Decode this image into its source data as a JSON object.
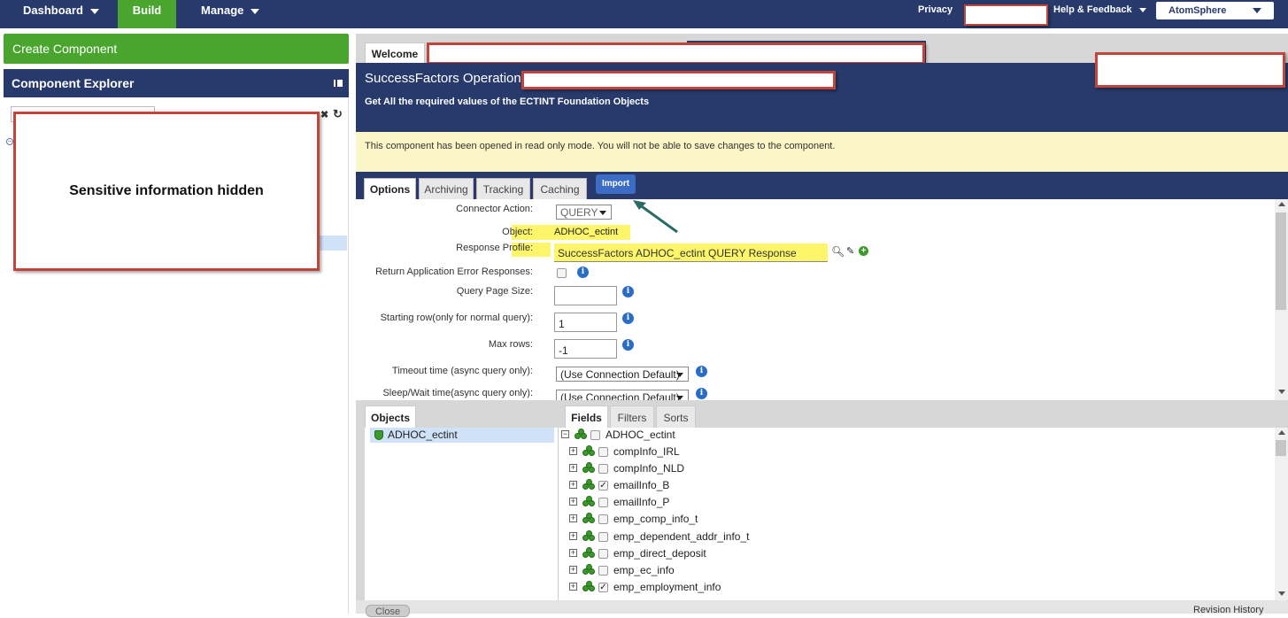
{
  "topnav": {
    "dashboard": "Dashboard",
    "build": "Build",
    "manage": "Manage",
    "privacy": "Privacy",
    "help": "Help & Feedback",
    "account": "AtomSphere"
  },
  "left": {
    "create_component": "Create Component",
    "explorer_title": "Component Explorer",
    "sensitive_notice": "Sensitive information hidden"
  },
  "editor": {
    "welcome_tab": "Welcome",
    "op_title": "SuccessFactors Operation: (",
    "op_description": "Get All the required values of the ECTINT Foundation Objects",
    "readonly_notice": "This component has been opened in read only mode. You will not be able to save changes to the component.",
    "tabs": [
      "Options",
      "Archiving",
      "Tracking",
      "Caching"
    ],
    "import_label": "Import"
  },
  "form": {
    "connector_action_label": "Connector Action:",
    "connector_action_value": "QUERY",
    "object_label": "Object:",
    "object_value": "ADHOC_ectint",
    "response_profile_label": "Response Profile:",
    "response_profile_value": "SuccessFactors ADHOC_ectint QUERY Response",
    "return_errors_label": "Return Application Error Responses:",
    "query_page_size_label": "Query Page Size:",
    "query_page_size_value": "",
    "starting_row_label": "Starting row(only for normal query):",
    "starting_row_value": "1",
    "max_rows_label": "Max rows:",
    "max_rows_value": "-1",
    "timeout_label": "Timeout time (async query only):",
    "timeout_value": "(Use Connection Default)",
    "sleep_label": "Sleep/Wait time(async query only):",
    "sleep_value": "(Use Connection Default)"
  },
  "bottom": {
    "objects_tab": "Objects",
    "fields_tab": "Fields",
    "filters_tab": "Filters",
    "sorts_tab": "Sorts",
    "object_item": "ADHOC_ectint",
    "root_field": "ADHOC_ectint",
    "fields": [
      {
        "name": "compInfo_IRL",
        "checked": false
      },
      {
        "name": "compInfo_NLD",
        "checked": false
      },
      {
        "name": "emailInfo_B",
        "checked": true
      },
      {
        "name": "emailInfo_P",
        "checked": false
      },
      {
        "name": "emp_comp_info_t",
        "checked": false
      },
      {
        "name": "emp_dependent_addr_info_t",
        "checked": false
      },
      {
        "name": "emp_direct_deposit",
        "checked": false
      },
      {
        "name": "emp_ec_info",
        "checked": false
      },
      {
        "name": "emp_employment_info",
        "checked": true
      }
    ],
    "close_label": "Close",
    "revision_history": "Revision History"
  }
}
